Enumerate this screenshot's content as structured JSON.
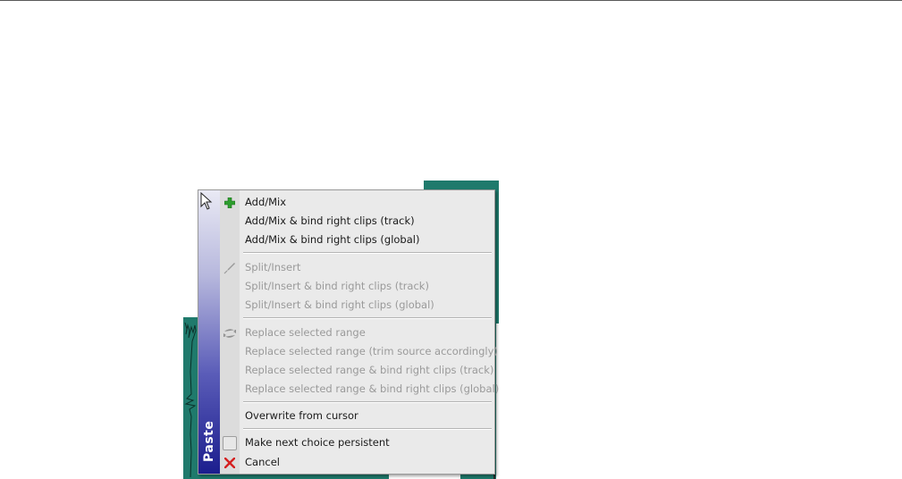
{
  "menu": {
    "title": "Paste",
    "items": [
      {
        "label": "Add/Mix",
        "icon": "plus-icon",
        "enabled": true
      },
      {
        "label": "Add/Mix & bind right clips (track)",
        "icon": "",
        "enabled": true
      },
      {
        "label": "Add/Mix & bind right clips (global)",
        "icon": "",
        "enabled": true
      },
      {
        "label": "Split/Insert",
        "icon": "split-icon",
        "enabled": false
      },
      {
        "label": "Split/Insert & bind right clips (track)",
        "icon": "",
        "enabled": false
      },
      {
        "label": "Split/Insert & bind right clips (global)",
        "icon": "",
        "enabled": false
      },
      {
        "label": "Replace selected range",
        "icon": "replace-icon",
        "enabled": false
      },
      {
        "label": "Replace selected range (trim source accordingly)",
        "icon": "",
        "enabled": false
      },
      {
        "label": "Replace selected range & bind right clips (track)",
        "icon": "",
        "enabled": false
      },
      {
        "label": "Replace selected range & bind right clips (global)",
        "icon": "",
        "enabled": false
      },
      {
        "label": "Overwrite from cursor",
        "icon": "",
        "enabled": true
      },
      {
        "label": "Make next choice persistent",
        "icon": "checkbox-icon",
        "enabled": true
      },
      {
        "label": "Cancel",
        "icon": "close-icon",
        "enabled": true
      }
    ]
  },
  "colors": {
    "track": "#1f7a6c",
    "menu_bg": "#eaeaea",
    "banner_dark": "#1c1e8e",
    "plus_green": "#2e9e2e",
    "cancel_red": "#d42020"
  }
}
